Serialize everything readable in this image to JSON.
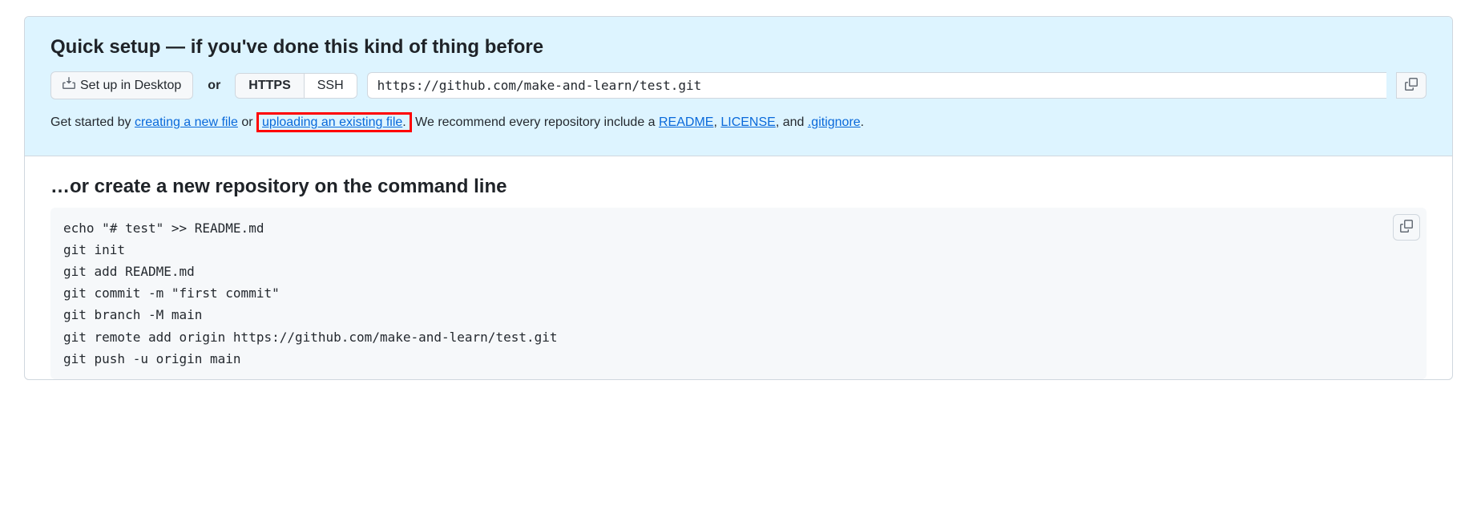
{
  "quick_setup": {
    "heading": "Quick setup — if you've done this kind of thing before",
    "desktop_button": "Set up in Desktop",
    "or_text": "or",
    "protocols": {
      "https": "HTTPS",
      "ssh": "SSH"
    },
    "clone_url": "https://github.com/make-and-learn/test.git",
    "get_started": {
      "prefix": "Get started by ",
      "create_file": "creating a new file",
      "or_text": " or ",
      "upload_file": "uploading an existing file",
      "middle": ". We recommend every repository include a ",
      "readme": "README",
      "sep1": ", ",
      "license": "LICENSE",
      "sep2": ", and ",
      "gitignore": ".gitignore",
      "suffix": "."
    }
  },
  "command_line": {
    "heading": "…or create a new repository on the command line",
    "code": "echo \"# test\" >> README.md\ngit init\ngit add README.md\ngit commit -m \"first commit\"\ngit branch -M main\ngit remote add origin https://github.com/make-and-learn/test.git\ngit push -u origin main"
  }
}
